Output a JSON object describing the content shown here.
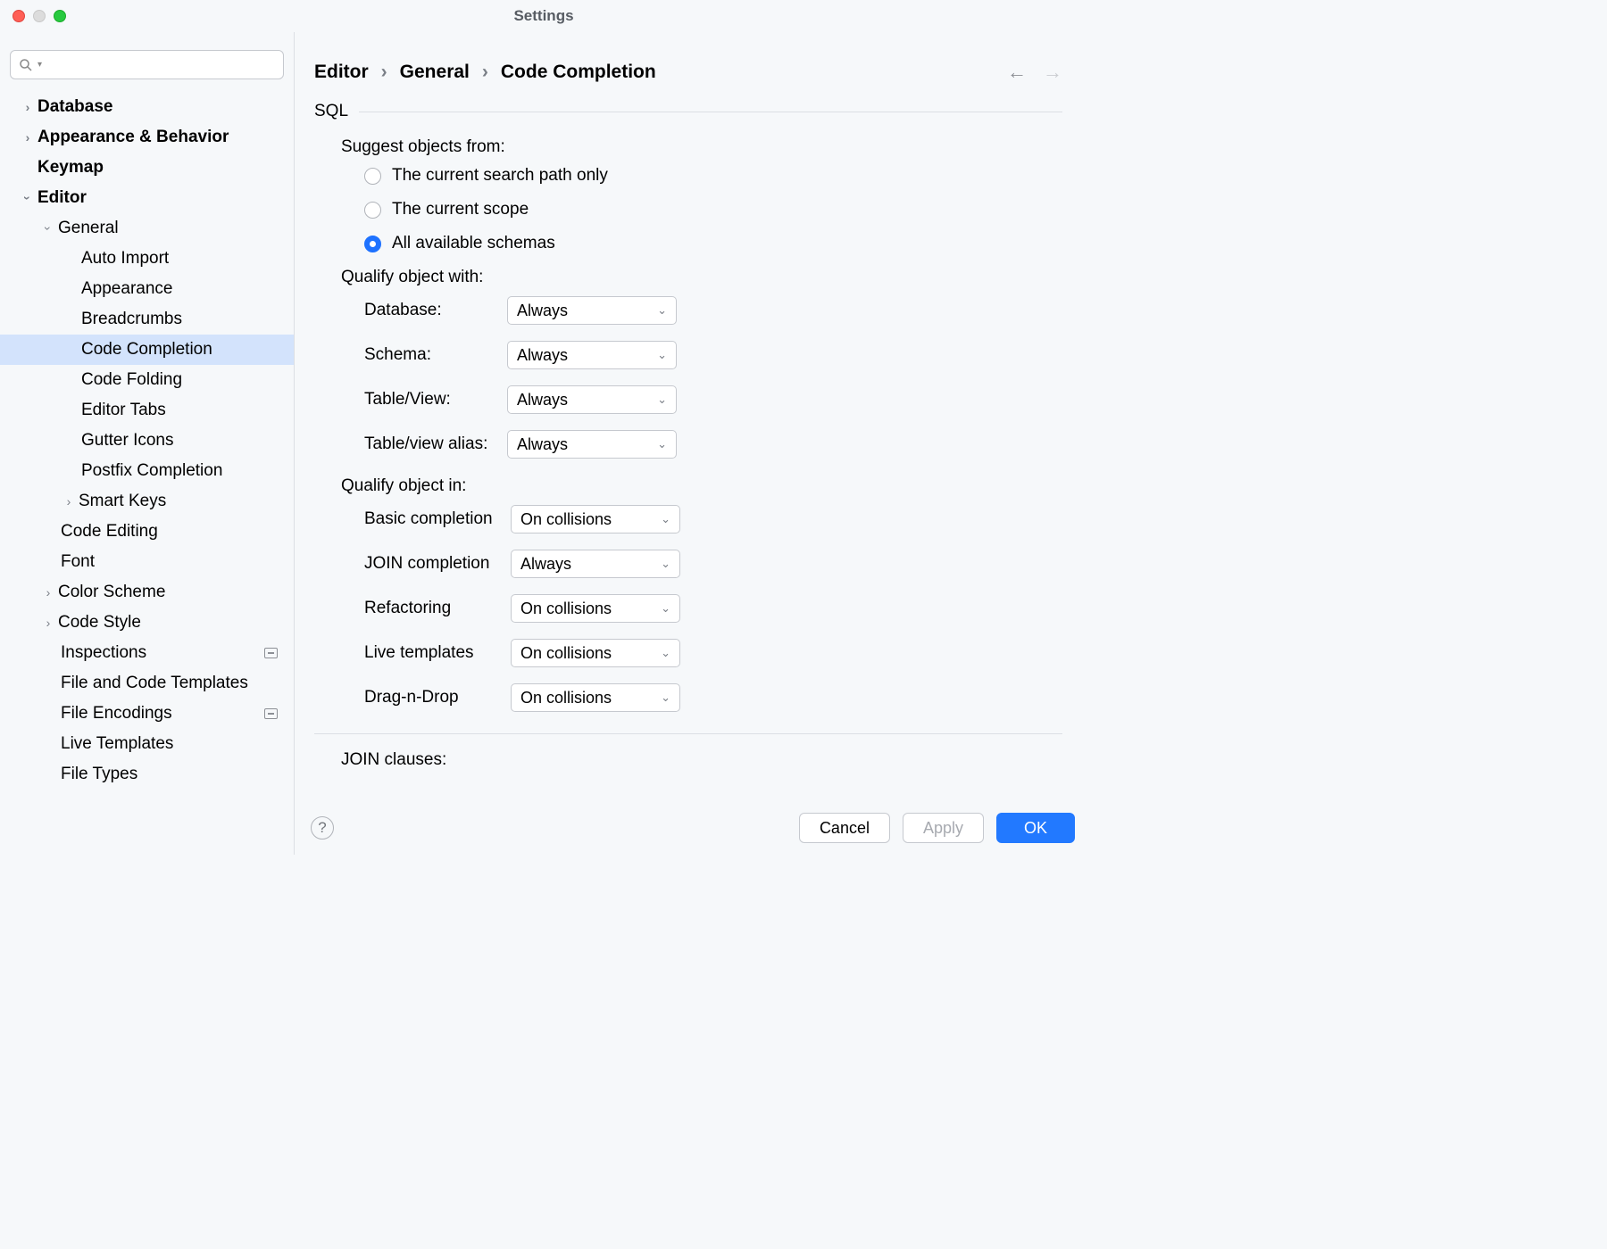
{
  "window": {
    "title": "Settings"
  },
  "search": {
    "placeholder": ""
  },
  "sidebar": {
    "items": [
      {
        "label": "Database"
      },
      {
        "label": "Appearance & Behavior"
      },
      {
        "label": "Keymap"
      },
      {
        "label": "Editor"
      },
      {
        "label": "General"
      },
      {
        "label": "Auto Import"
      },
      {
        "label": "Appearance"
      },
      {
        "label": "Breadcrumbs"
      },
      {
        "label": "Code Completion"
      },
      {
        "label": "Code Folding"
      },
      {
        "label": "Editor Tabs"
      },
      {
        "label": "Gutter Icons"
      },
      {
        "label": "Postfix Completion"
      },
      {
        "label": "Smart Keys"
      },
      {
        "label": "Code Editing"
      },
      {
        "label": "Font"
      },
      {
        "label": "Color Scheme"
      },
      {
        "label": "Code Style"
      },
      {
        "label": "Inspections"
      },
      {
        "label": "File and Code Templates"
      },
      {
        "label": "File Encodings"
      },
      {
        "label": "Live Templates"
      },
      {
        "label": "File Types"
      }
    ]
  },
  "breadcrumb": {
    "a": "Editor",
    "b": "General",
    "c": "Code Completion"
  },
  "sql": {
    "heading": "SQL",
    "suggest_label": "Suggest objects from:",
    "radios": {
      "r0": "The current search path only",
      "r1": "The current scope",
      "r2": "All available schemas"
    },
    "qualify_with": {
      "title": "Qualify object with:",
      "rows": {
        "database": {
          "label": "Database:",
          "value": "Always"
        },
        "schema": {
          "label": "Schema:",
          "value": "Always"
        },
        "tableview": {
          "label": "Table/View:",
          "value": "Always"
        },
        "tvalias": {
          "label": "Table/view alias:",
          "value": "Always"
        }
      }
    },
    "qualify_in": {
      "title": "Qualify object in:",
      "rows": {
        "basic": {
          "label": "Basic completion",
          "value": "On collisions"
        },
        "join": {
          "label": "JOIN completion",
          "value": "Always"
        },
        "refactoring": {
          "label": "Refactoring",
          "value": "On collisions"
        },
        "live": {
          "label": "Live templates",
          "value": "On collisions"
        },
        "dnd": {
          "label": "Drag-n-Drop",
          "value": "On collisions"
        }
      }
    },
    "join_clauses": "JOIN clauses:"
  },
  "footer": {
    "cancel": "Cancel",
    "apply": "Apply",
    "ok": "OK"
  }
}
